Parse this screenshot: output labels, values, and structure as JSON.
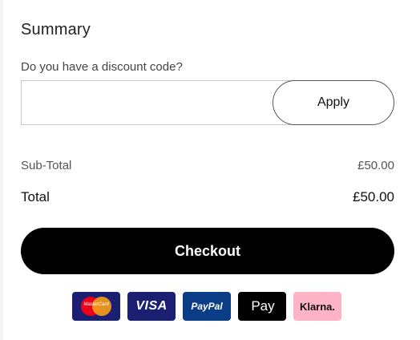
{
  "summary": {
    "title": "Summary",
    "discount_label": "Do you have a discount code?",
    "discount_input_value": "",
    "apply_label": "Apply",
    "subtotal_label": "Sub-Total",
    "subtotal_value": "£50.00",
    "total_label": "Total",
    "total_value": "£50.00",
    "checkout_label": "Checkout"
  },
  "payment_methods": {
    "mastercard_text": "MasterCard",
    "visa_label": "VISA",
    "paypal_label": "PayPal",
    "applepay_logo": "",
    "applepay_label": "Pay",
    "klarna_label": "Klarna."
  },
  "colors": {
    "checkout_bg": "#000000",
    "mastercard_bg": "#1a1f71",
    "visa_bg": "#1a1f71",
    "paypal_bg": "#0b3c86",
    "applepay_bg": "#000000",
    "klarna_bg": "#ffb3c7"
  }
}
